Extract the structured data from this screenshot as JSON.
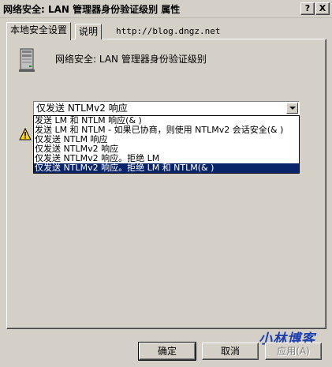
{
  "window": {
    "title": "网络安全: LAN 管理器身份验证级别 属性",
    "help_label": "?",
    "close_label": "X"
  },
  "tabs": [
    {
      "label": "本地安全设置",
      "active": true
    },
    {
      "label": "说明",
      "active": false
    }
  ],
  "url_text": "http://blog.dngz.net",
  "policy": {
    "icon": "server-computer-icon",
    "title": "网络安全: LAN 管理器身份验证级别"
  },
  "dropdown": {
    "selected": "仅发送 NTLMv2 响应",
    "options": [
      "发送 LM 和 NTLM 响应(& )",
      "发送 LM 和 NTLM - 如果已协商，则使用 NTLMv2 会话安全(& )",
      "仅发送 NTLM 响应",
      "仅发送 NTLMv2 响应",
      "仅发送 NTLMv2 响应。拒绝 LM",
      "仅发送 NTLMv2 响应。拒绝 LM 和 NTLM(& )"
    ],
    "highlighted_index": 5
  },
  "warning_icon": "warning-icon",
  "buttons": {
    "ok": "确定",
    "cancel": "取消",
    "apply": "应用(A)"
  },
  "watermark": "小林博客",
  "colors": {
    "face": "#d4d0c8",
    "highlight": "#0a246a",
    "watermark": "#1e3fae"
  }
}
